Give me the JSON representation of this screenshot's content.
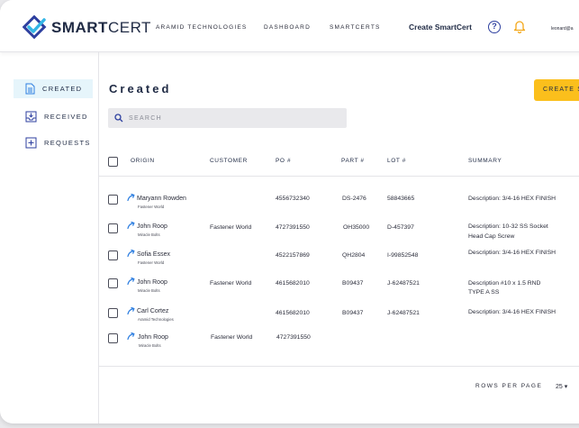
{
  "brand": {
    "name_bold": "SMART",
    "name_rest": "CERT"
  },
  "nav": {
    "links": [
      "ARAMID TECHNOLOGIES",
      "DASHBOARD",
      "SMARTCERTS"
    ],
    "create": "Create SmartCert",
    "help": "?",
    "user": "leonard@a"
  },
  "sidebar": {
    "items": [
      {
        "label": "CREATED",
        "icon": "document-icon",
        "active": true
      },
      {
        "label": "RECEIVED",
        "icon": "inbox-icon",
        "active": false
      },
      {
        "label": "REQUESTS",
        "icon": "add-box-icon",
        "active": false
      }
    ]
  },
  "main": {
    "title": "Created",
    "create_button": "CREATE S",
    "search_placeholder": "SEARCH"
  },
  "table": {
    "columns": [
      "ORIGIN",
      "CUSTOMER",
      "PO #",
      "PART #",
      "LOT #",
      "SUMMARY"
    ],
    "rows": [
      {
        "name": "Maryann Rowden",
        "company": "Fastener World",
        "customer": "",
        "po": "4556732340",
        "part": "DS-2476",
        "lot": "58843665",
        "summary1": "Description: 3/4-16 HEX FINISH",
        "summary2": ""
      },
      {
        "name": "John Roop",
        "company": "Miracle Bolts",
        "customer": "Fastener World",
        "po": "4727391550",
        "part": "OH35000",
        "lot": "D-457397",
        "summary1": "Description: 10-32 SS Socket",
        "summary2": "Head Cap Screw"
      },
      {
        "name": "Sofia Essex",
        "company": "Fastener World",
        "customer": "",
        "po": "4522157869",
        "part": "QH2804",
        "lot": "I-99852548",
        "summary1": "Description: 3/4-16 HEX FINISH",
        "summary2": ""
      },
      {
        "name": "John Roop",
        "company": "Miracle Bolts",
        "customer": "Fastener World",
        "po": "4615682010",
        "part": "B09437",
        "lot": "J-62487521",
        "summary1": "Description #10 x 1.5 RND",
        "summary2": "TYPE A SS"
      },
      {
        "name": "Carl Cortez",
        "company": "Aramid Technologies",
        "customer": "",
        "po": "4615682010",
        "part": "B09437",
        "lot": "J-62487521",
        "summary1": "Description: 3/4-16 HEX FINISH",
        "summary2": ""
      },
      {
        "name": "John Roop",
        "company": "Miracle Bolts",
        "customer": "Fastener World",
        "po": "4727391550",
        "part": "",
        "lot": "",
        "summary1": "",
        "summary2": ""
      }
    ]
  },
  "pagination": {
    "label": "ROWS PER PAGE",
    "value": "25 ▾"
  },
  "colors": {
    "accent": "#fbbf1c",
    "brand_navy": "#1f2a44",
    "brand_blue": "#2d7ee0",
    "active_bg": "#e6f5fb"
  }
}
